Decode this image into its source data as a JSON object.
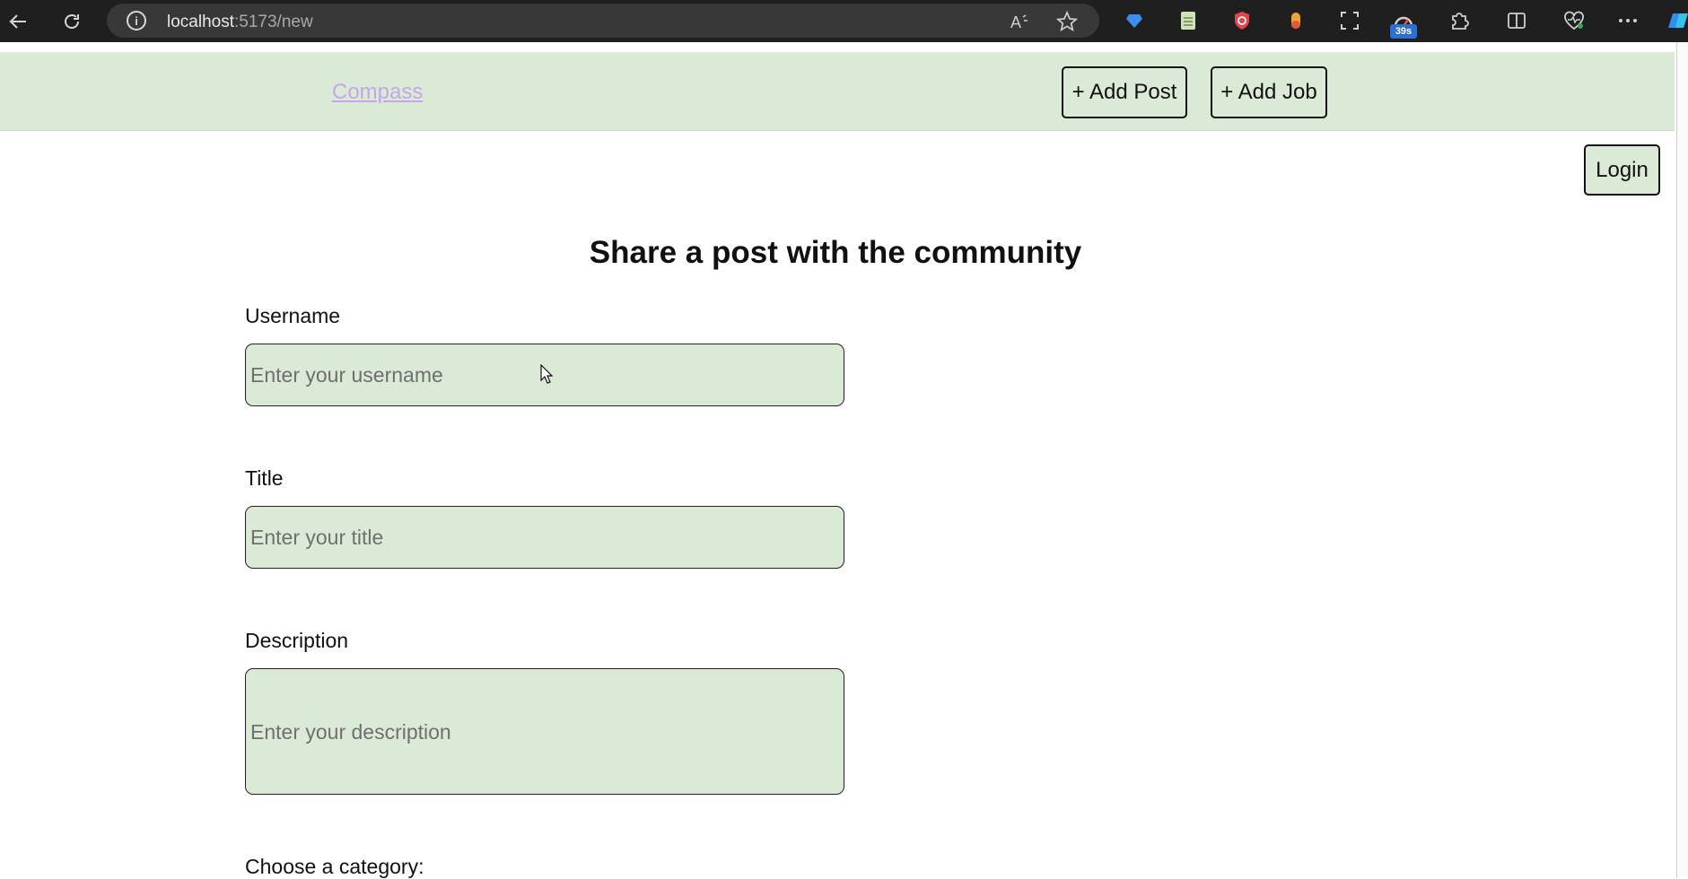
{
  "browser": {
    "url_host": "localhost",
    "url_path": ":5173/new",
    "extension_badge": "39s"
  },
  "nav": {
    "brand": "Compass",
    "add_post": "+ Add Post",
    "add_job": "+ Add Job"
  },
  "login": "Login",
  "form": {
    "heading": "Share a post with the community",
    "username_label": "Username",
    "username_placeholder": "Enter your username",
    "title_label": "Title",
    "title_placeholder": "Enter your title",
    "description_label": "Description",
    "description_placeholder": "Enter your description",
    "category_label": "Choose a category:"
  },
  "colors": {
    "accent_green": "#dbead6",
    "brand_link": "#c6a6e6"
  },
  "icons": [
    "back-icon",
    "refresh-icon",
    "info-icon",
    "read-aloud-icon",
    "favorite-star-icon",
    "extension-icons",
    "split-screen-icon",
    "health-icon",
    "more-icon",
    "copilot-icon"
  ]
}
